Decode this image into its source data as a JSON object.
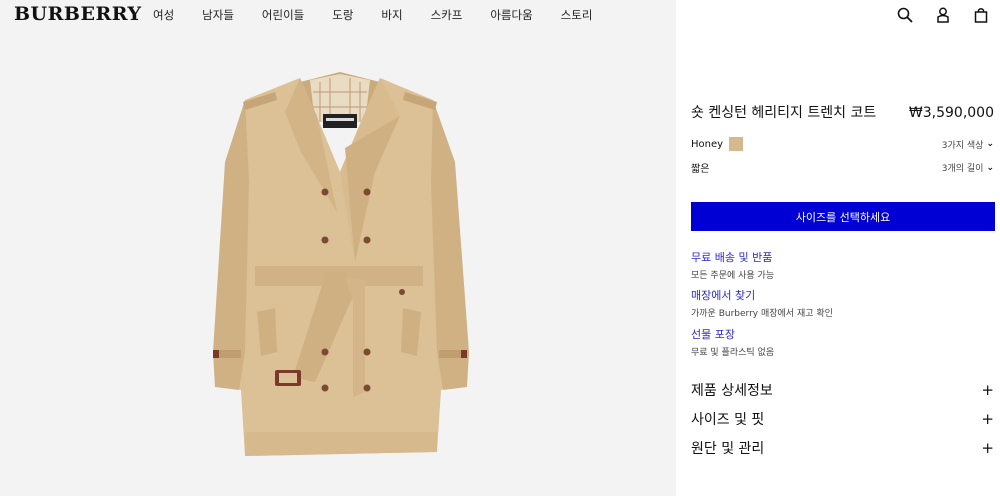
{
  "brand": {
    "logo": "BURBERRY"
  },
  "nav": {
    "items": [
      "여성",
      "남자들",
      "어린이들",
      "도랑",
      "바지",
      "스카프",
      "아름다움",
      "스토리"
    ]
  },
  "header_icons": [
    "search-icon",
    "account-icon",
    "shopping-bag-icon"
  ],
  "product": {
    "title": "숏 켄싱턴 헤리티지 트렌치 코트",
    "price": "₩3,590,000",
    "image_alt": "honey-trench-coat"
  },
  "options": {
    "color": {
      "value": "Honey",
      "swatch_color": "#d6b88e",
      "more_label": "3가지 색상"
    },
    "length": {
      "value": "짧은",
      "more_label": "3개의 길이"
    }
  },
  "size_button": {
    "label": "사이즈를 선택하세요",
    "color": "#0000d4"
  },
  "services": [
    {
      "title": "무료 배송 및 반품",
      "subtitle": "모든 주문에 사용 가능"
    },
    {
      "title": "매장에서 찾기",
      "subtitle": "가까운 Burberry 매장에서 재고 확인"
    },
    {
      "title": "선물 포장",
      "subtitle": "무료 및 플라스틱 없음"
    }
  ],
  "accordions": [
    {
      "label": "제품 상세정보",
      "icon": "plus-icon"
    },
    {
      "label": "사이즈 및 핏",
      "icon": "plus-icon"
    },
    {
      "label": "원단 및 관리",
      "icon": "plus-icon"
    }
  ],
  "colors": {
    "accent": "#0000d4",
    "link": "#2a2ac8",
    "image_bg": "#f3f3f3"
  }
}
